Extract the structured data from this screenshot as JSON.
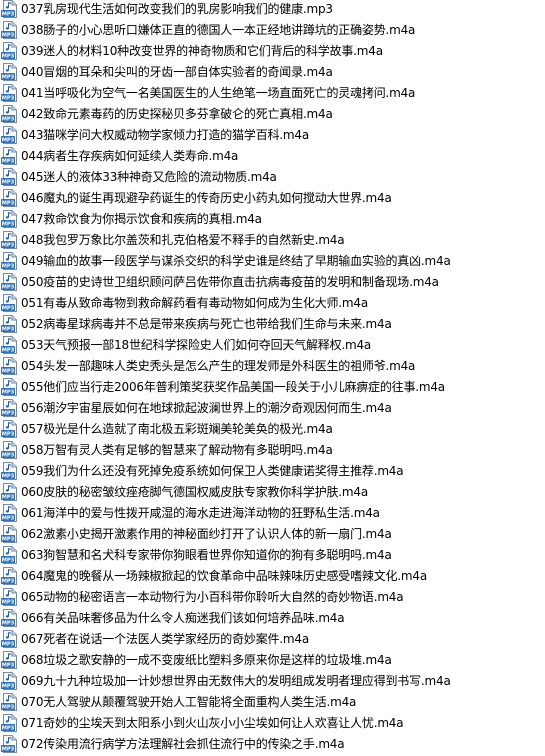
{
  "files": [
    {
      "name": "037乳房现代生活如何改变我们的乳房影响我们的健康.mp3",
      "icon": "audio-file-icon"
    },
    {
      "name": "038肠子的小心思听口嫌体正直的德国人一本正经地讲蹲坑的正确姿势.m4a",
      "icon": "audio-file-icon"
    },
    {
      "name": "039迷人的材料10种改变世界的神奇物质和它们背后的科学故事.m4a",
      "icon": "audio-file-icon"
    },
    {
      "name": "040冒烟的耳朵和尖叫的牙齿一部自体实验者的奇闻录.m4a",
      "icon": "audio-file-icon"
    },
    {
      "name": "041当呼吸化为空气一名美国医生的人生绝笔一场直面死亡的灵魂拷问.m4a",
      "icon": "audio-file-icon"
    },
    {
      "name": "042致命元素毒药的历史探秘贝多芬拿破仑的死亡真相.m4a",
      "icon": "audio-file-icon"
    },
    {
      "name": "043猫咪学问大权威动物学家倾力打造的猫学百科.m4a",
      "icon": "audio-file-icon"
    },
    {
      "name": "044病者生存疾病如何延续人类寿命.m4a",
      "icon": "audio-file-icon"
    },
    {
      "name": "045迷人的液体33种神奇又危险的流动物质.m4a",
      "icon": "audio-file-icon"
    },
    {
      "name": "046魔丸的诞生再现避孕药诞生的传奇历史小药丸如何搅动大世界.m4a",
      "icon": "audio-file-icon"
    },
    {
      "name": "047救命饮食为你揭示饮食和疾病的真相.m4a",
      "icon": "audio-file-icon"
    },
    {
      "name": "048我包罗万象比尔盖茨和扎克伯格爱不释手的自然新史.m4a",
      "icon": "audio-file-icon"
    },
    {
      "name": "049输血的故事一段医学与谋杀交织的科学史谁是终结了早期输血实验的真凶.m4a",
      "icon": "audio-file-icon"
    },
    {
      "name": "050疫苗的史诗世卫组织顾问萨吕佐带你直击抗病毒疫苗的发明和制备现场.m4a",
      "icon": "audio-file-icon"
    },
    {
      "name": "051有毒从致命毒物到救命解药看有毒动物如何成为生化大师.m4a",
      "icon": "audio-file-icon"
    },
    {
      "name": "052病毒星球病毒并不总是带来疾病与死亡也带给我们生命与未来.m4a",
      "icon": "audio-file-icon"
    },
    {
      "name": "053天气预报一部18世纪科学探险史人们如何夺回天气解释权.m4a",
      "icon": "audio-file-icon"
    },
    {
      "name": "054头发一部趣味人类史秃头是怎么产生的理发师是外科医生的祖师爷.m4a",
      "icon": "audio-file-icon"
    },
    {
      "name": "055他们应当行走2006年普利策奖获奖作品美国一段关于小儿麻痹症的往事.m4a",
      "icon": "audio-file-icon"
    },
    {
      "name": "056潮汐宇宙星辰如何在地球掀起波澜世界上的潮汐奇观因何而生.m4a",
      "icon": "audio-file-icon"
    },
    {
      "name": "057极光是什么造就了南北极五彩斑斓美轮美奂的极光.m4a",
      "icon": "audio-file-icon"
    },
    {
      "name": "058万智有灵人类有足够的智慧来了解动物有多聪明吗.m4a",
      "icon": "audio-file-icon"
    },
    {
      "name": "059我们为什么还没有死掉免疫系统如何保卫人类健康诺奖得主推荐.m4a",
      "icon": "audio-file-icon"
    },
    {
      "name": "060皮肤的秘密皱纹痤疮脚气德国权威皮肤专家教你科学护肤.m4a",
      "icon": "audio-file-icon"
    },
    {
      "name": "061海洋中的爱与性拨开咸湿的海水走进海洋动物的狂野私生活.m4a",
      "icon": "audio-file-icon"
    },
    {
      "name": "062激素小史揭开激素作用的神秘面纱打开了认识人体的新一扇门.m4a",
      "icon": "audio-file-icon"
    },
    {
      "name": "063狗智慧和名犬科专家带你狗眼看世界你知道你的狗有多聪明吗.m4a",
      "icon": "audio-file-icon"
    },
    {
      "name": "064魔鬼的晚餐从一场辣椒掀起的饮食革命中品味辣味历史感受嗜辣文化.m4a",
      "icon": "audio-file-icon"
    },
    {
      "name": "065动物的秘密语言一本动物行为小百科带你聆听大自然的奇妙物语.m4a",
      "icon": "audio-file-icon"
    },
    {
      "name": "066有关品味奢侈品为什么令人痴迷我们该如何培养品味.m4a",
      "icon": "audio-file-icon"
    },
    {
      "name": "067死者在说话一个法医人类学家经历的奇妙案件.m4a",
      "icon": "audio-file-icon"
    },
    {
      "name": "068垃圾之歌安静的一成不变废纸比塑料多原来你是这样的垃圾堆.m4a",
      "icon": "audio-file-icon"
    },
    {
      "name": "069九十九种垃圾加一计妙想世界由无数伟大的发明组成发明者理应得到书写.m4a",
      "icon": "audio-file-icon"
    },
    {
      "name": "070无人驾驶从颠覆驾驶开始人工智能将全面重构人类生活.m4a",
      "icon": "audio-file-icon"
    },
    {
      "name": "071奇妙的尘埃天到太阳系小到火山灰小小尘埃如何让人欢喜让人忧.m4a",
      "icon": "audio-file-icon"
    },
    {
      "name": "072传染用流行病学方法理解社会抓住流行中的传染之手.m4a",
      "icon": "audio-file-icon"
    }
  ],
  "colors": {
    "icon_page": "#ffffff",
    "icon_border": "#7a8aa0",
    "icon_fold": "#c9d4e2",
    "icon_badge": "#2f6fb8",
    "icon_note": "#1f5ea8",
    "icon_text": "#ffffff",
    "label_text": "#000000"
  }
}
